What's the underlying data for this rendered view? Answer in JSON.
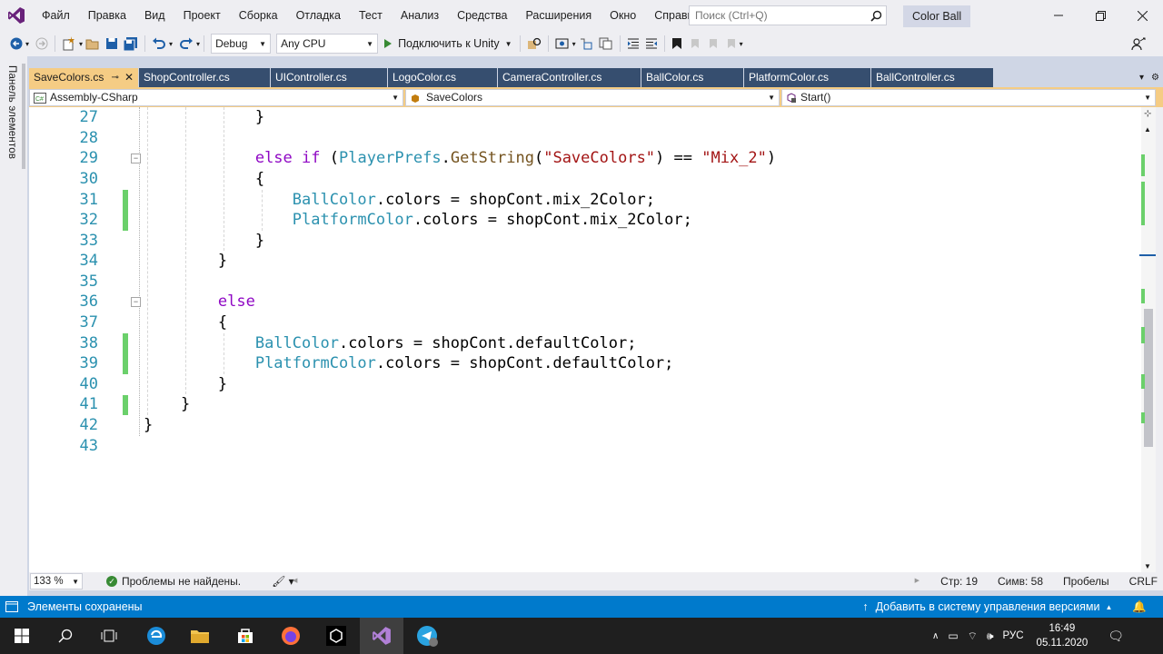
{
  "menu": [
    "Файл",
    "Правка",
    "Вид",
    "Проект",
    "Сборка",
    "Отладка",
    "Тест",
    "Анализ",
    "Средства",
    "Расширения",
    "Окно",
    "Справка"
  ],
  "search": {
    "placeholder": "Поиск (Ctrl+Q)"
  },
  "solution_name": "Color Ball",
  "toolbar": {
    "config": "Debug",
    "platform": "Any CPU",
    "attach_label": "Подключить к Unity"
  },
  "left_panel_label": "Панель элементов",
  "tabs": [
    {
      "label": "SaveColors.cs",
      "active": true
    },
    {
      "label": "ShopController.cs"
    },
    {
      "label": "UIController.cs"
    },
    {
      "label": "LogoColor.cs"
    },
    {
      "label": "CameraController.cs"
    },
    {
      "label": "BallColor.cs"
    },
    {
      "label": "PlatformColor.cs"
    },
    {
      "label": "BallController.cs"
    }
  ],
  "navbar": {
    "project": "Assembly-CSharp",
    "class": "SaveColors",
    "member": "Start()"
  },
  "line_numbers": [
    "27",
    "28",
    "29",
    "30",
    "31",
    "32",
    "33",
    "34",
    "35",
    "36",
    "37",
    "38",
    "39",
    "40",
    "41",
    "42",
    "43"
  ],
  "editor_status": {
    "zoom": "133 %",
    "problems": "Проблемы не найдены.",
    "line": "Стр: 19",
    "col": "Симв: 58",
    "whitespace": "Пробелы",
    "eol": "CRLF"
  },
  "statusbar": {
    "left": "Элементы сохранены",
    "right": "Добавить в систему управления версиями"
  },
  "clock": {
    "time": "16:49",
    "date": "05.11.2020",
    "lang": "РУС"
  },
  "colors": {
    "accent": "#007acc",
    "tab_active": "#f5cc84",
    "tab_inactive": "#364e6f",
    "change_marker": "#6bd06b",
    "keyword": "#8f08c4",
    "type": "#2b91af",
    "string": "#a31515"
  }
}
